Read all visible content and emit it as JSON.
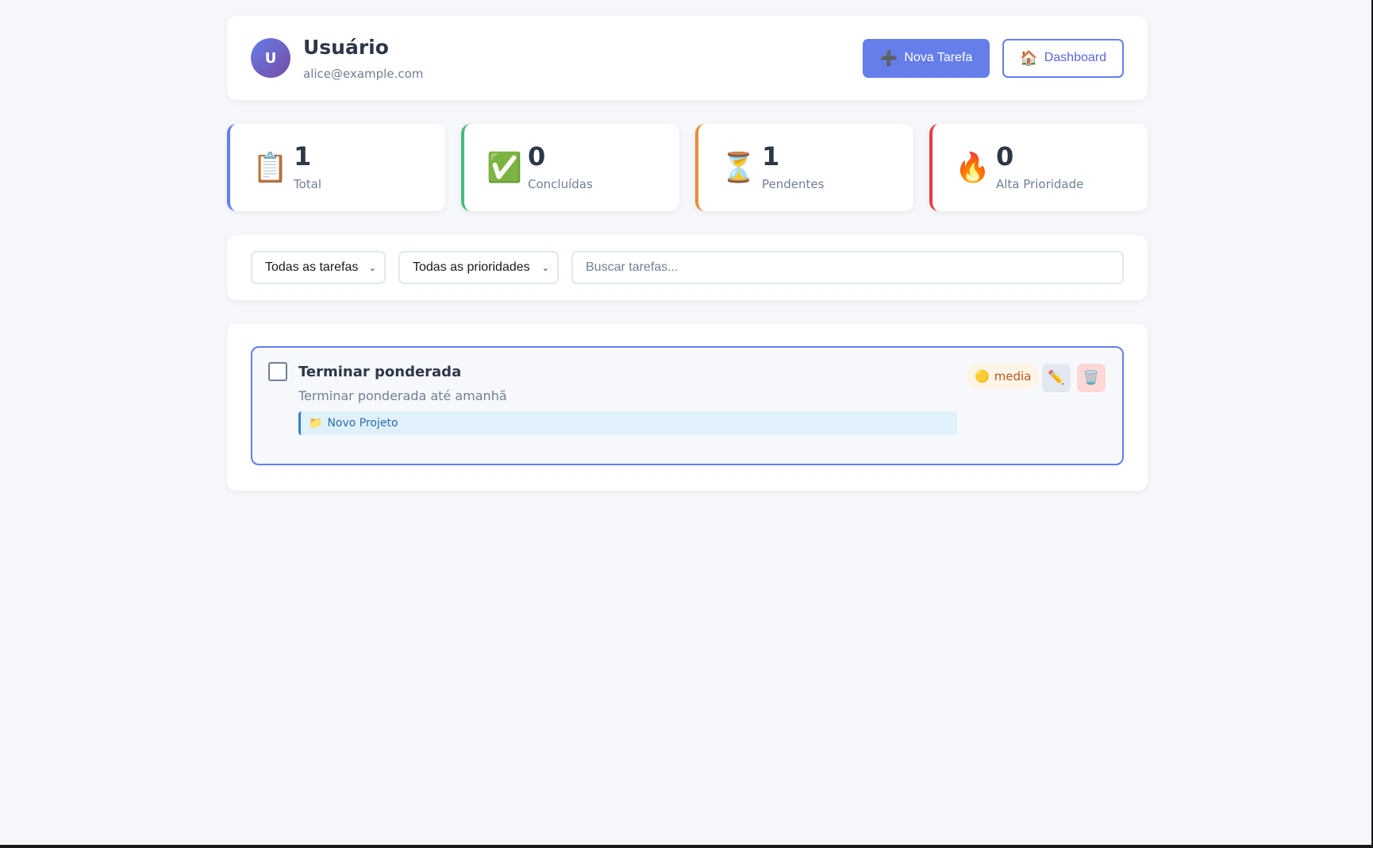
{
  "header": {
    "avatar_initial": "U",
    "user_name": "Usuário",
    "user_email": "alice@example.com",
    "new_task_icon": "➕",
    "new_task_label": "Nova Tarefa",
    "dashboard_icon": "🏠",
    "dashboard_label": "Dashboard"
  },
  "stats": [
    {
      "icon": "📋",
      "icon_name": "clipboard-icon",
      "value": "1",
      "label": "Total"
    },
    {
      "icon": "✅",
      "icon_name": "check-icon",
      "value": "0",
      "label": "Concluídas"
    },
    {
      "icon": "⏳",
      "icon_name": "hourglass-icon",
      "value": "1",
      "label": "Pendentes"
    },
    {
      "icon": "🔥",
      "icon_name": "fire-icon",
      "value": "0",
      "label": "Alta Prioridade"
    }
  ],
  "filters": {
    "status_selected": "Todas as tarefas",
    "priority_selected": "Todas as prioridades",
    "search_placeholder": "Buscar tarefas...",
    "search_value": ""
  },
  "tasks": [
    {
      "title": "Terminar ponderada",
      "description": "Terminar ponderada até amanhã",
      "project_icon": "📁",
      "project": "Novo Projeto",
      "priority_icon": "🟡",
      "priority": "media",
      "edit_icon": "✏️",
      "delete_icon": "🗑️",
      "completed": false
    }
  ],
  "colors": {
    "accent": "#667eea",
    "completed": "#48bb78",
    "pending": "#ed8936",
    "high_priority": "#e53e3e"
  }
}
